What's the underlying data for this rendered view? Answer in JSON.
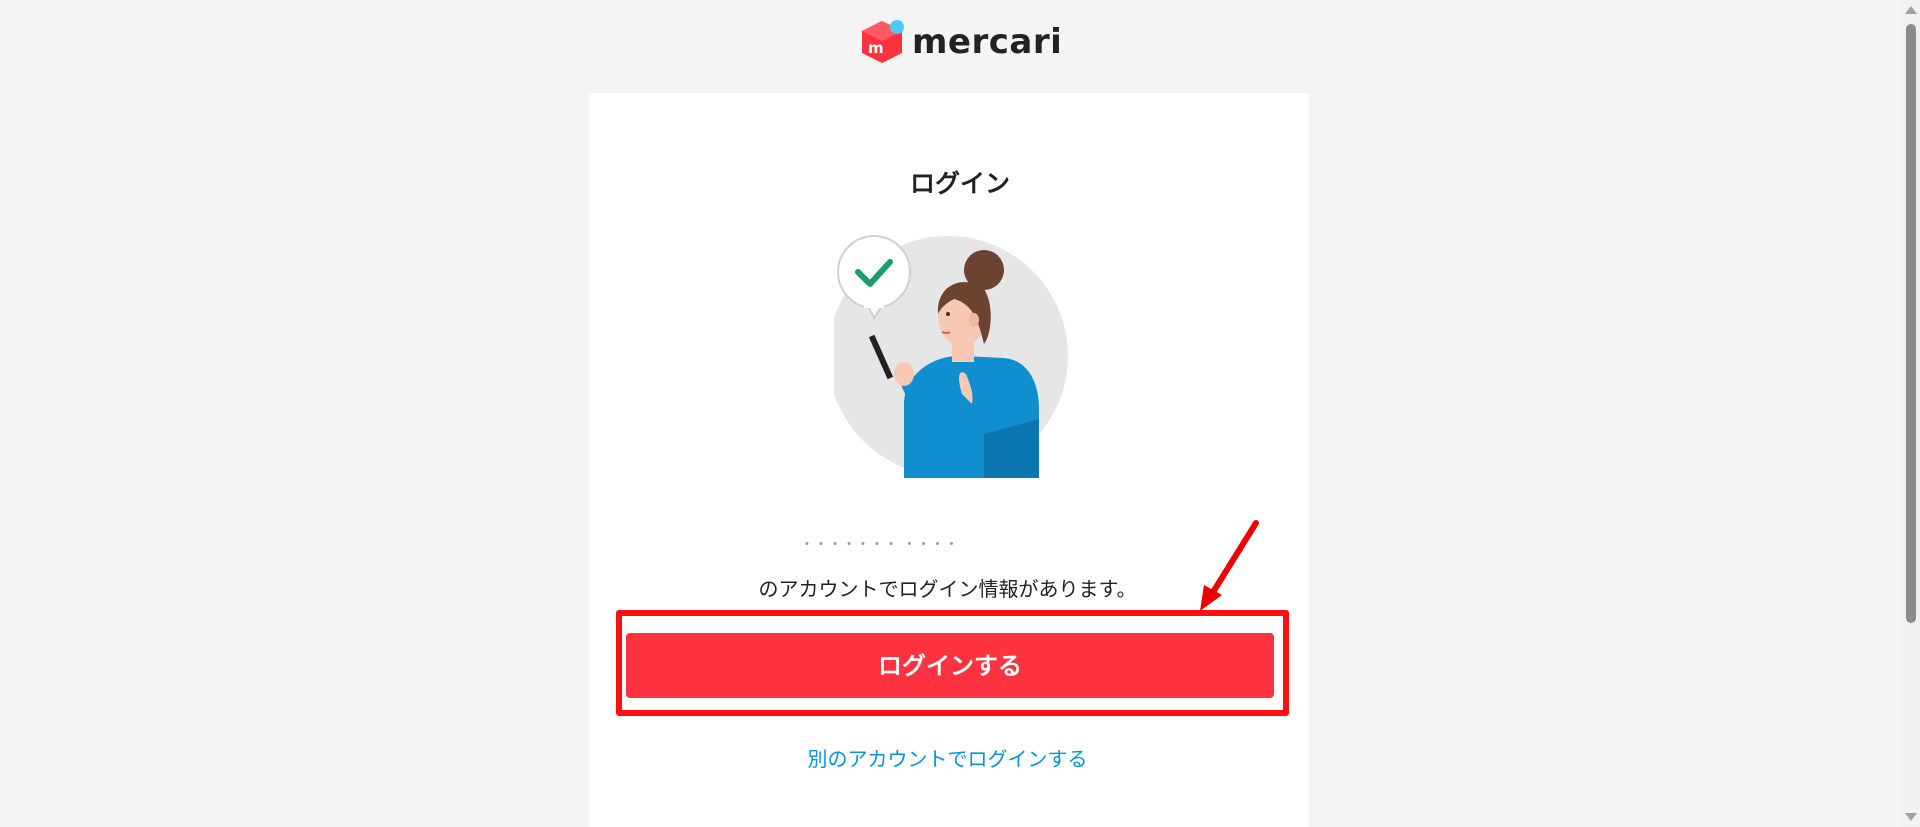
{
  "brand": {
    "name": "mercari",
    "mark_letter": "m",
    "primary_color": "#ff333f",
    "accent_color": "#4dc9ff"
  },
  "card": {
    "title": "ログイン",
    "masked_account": "・・・・・・・ ・・・・",
    "account_message": "のアカウントでログイン情報があります。",
    "login_button_label": "ログインする",
    "other_account_link": "別のアカウントでログインする"
  },
  "annotations": {
    "highlight_color": "#ff1010",
    "arrow_color": "#ee0000"
  },
  "illustration": {
    "icon": "woman-with-phone-checkmark-illustration"
  }
}
